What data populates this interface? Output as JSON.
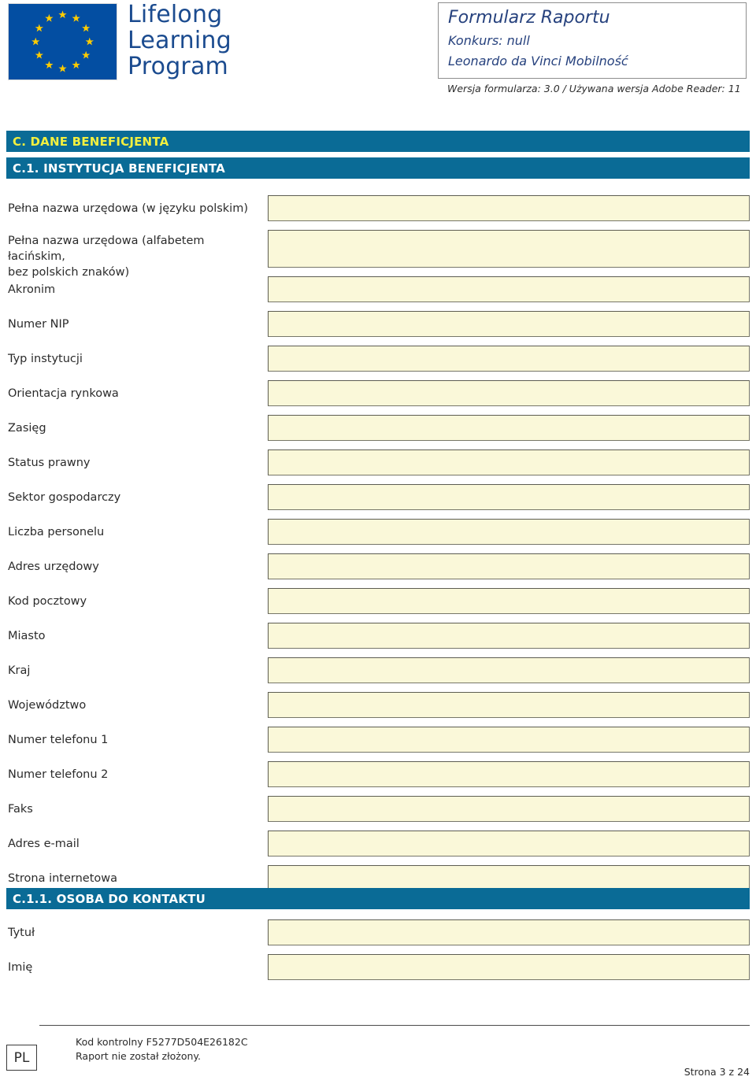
{
  "header": {
    "brand_lines": [
      "Lifelong",
      "Learning",
      "Program"
    ],
    "flag_alt": "european-union-flag",
    "title": "Formularz Raportu",
    "subtitle_1": "Konkurs: null",
    "subtitle_2": "Leonardo da Vinci Mobilność",
    "version_line": "Wersja formularza: 3.0 / Używana wersja Adobe Reader: 11"
  },
  "sections": {
    "section_c": "C. DANE BENEFICJENTA",
    "section_c1": "C.1. INSTYTUCJA BENEFICJENTA",
    "section_c11": "C.1.1. OSOBA DO KONTAKTU"
  },
  "institution_fields": [
    {
      "label": "Pełna nazwa urzędowa (w języku polskim)",
      "value": ""
    },
    {
      "label": "Pełna nazwa urzędowa (alfabetem łacińskim,\nbez polskich znaków)",
      "value": ""
    },
    {
      "label": "Akronim",
      "value": ""
    },
    {
      "label": "Numer NIP",
      "value": ""
    },
    {
      "label": "Typ instytucji",
      "value": ""
    },
    {
      "label": "Orientacja rynkowa",
      "value": ""
    },
    {
      "label": "Zasięg",
      "value": ""
    },
    {
      "label": "Status prawny",
      "value": ""
    },
    {
      "label": "Sektor gospodarczy",
      "value": ""
    },
    {
      "label": "Liczba personelu",
      "value": ""
    },
    {
      "label": "Adres urzędowy",
      "value": ""
    },
    {
      "label": "Kod pocztowy",
      "value": ""
    },
    {
      "label": "Miasto",
      "value": ""
    },
    {
      "label": "Kraj",
      "value": ""
    },
    {
      "label": "Województwo",
      "value": ""
    },
    {
      "label": "Numer telefonu 1",
      "value": ""
    },
    {
      "label": "Numer telefonu 2",
      "value": ""
    },
    {
      "label": "Faks",
      "value": ""
    },
    {
      "label": "Adres e-mail",
      "value": ""
    },
    {
      "label": "Strona internetowa",
      "value": ""
    }
  ],
  "contact_fields": [
    {
      "label": "Tytuł",
      "value": ""
    },
    {
      "label": "Imię",
      "value": ""
    }
  ],
  "footer": {
    "badge": "PL",
    "control_code": "Kod kontrolny F5277D504E26182C",
    "status": "Raport nie został złożony.",
    "page": "Strona 3 z 24"
  },
  "colors": {
    "band_blue": "#0a6b96",
    "band_yellow_text": "#f2ef3f",
    "field_fill": "#faf8d9",
    "field_border": "#767668",
    "brand_navy": "#1b4b8f",
    "title_navy": "#27427e",
    "flag_blue": "#034ea2",
    "star_yellow": "#ffcc00"
  }
}
